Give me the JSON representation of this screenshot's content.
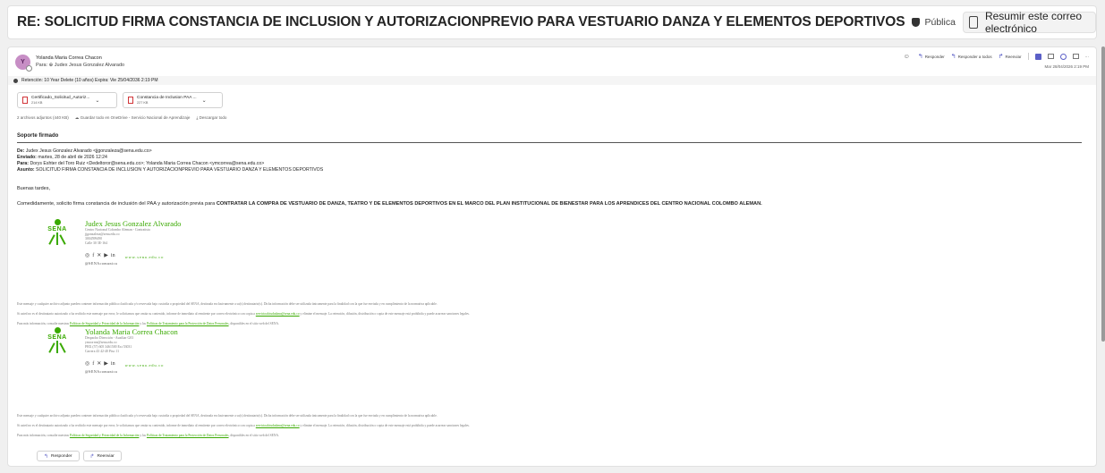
{
  "subject": "RE: SOLICITUD FIRMA CONSTANCIA DE INCLUSION Y AUTORIZACIONPREVIO PARA VESTUARIO DANZA Y ELEMENTOS DEPORTIVOS",
  "label": "Pública",
  "summarize_label": "Resumir este correo electrónico",
  "header": {
    "avatar_initials": "Y",
    "sender_name": "Yolanda Maria Correa Chacon",
    "to_line": "Para: ⊕ Judex Jesus Gonzalez Alvarado",
    "date": "Mar 28/04/2026 2:19 PM",
    "actions": {
      "reply": "Responder",
      "reply_all": "Responder a todos",
      "forward": "Reenviar"
    }
  },
  "retention": "Retención: 10 Year Delete (10 años) Expira: Vie 25/04/2036 2:19 PM",
  "attachments": [
    {
      "name": "Certificado_Solicitud_Autoriz...",
      "size": "214 KB"
    },
    {
      "name": "Constancia de Inclusion PAA ...",
      "size": "227 KB"
    }
  ],
  "attachment_line": {
    "count": "2 archivos adjuntos (440 KB)",
    "save": "Guardar todo en OneDrive - Servicio Nacional de Aprendizaje",
    "download": "Descargar todo"
  },
  "soporte": "Soporte firmado",
  "meta": {
    "from_label": "De:",
    "from": "Judex Jesus Gonzalez Alvarado <jjgonzaleza@sena.edu.co>",
    "sent_label": "Enviado:",
    "sent": "martes, 28 de abril de 2026 12:24",
    "to_label": "Para:",
    "to": "Dorys Eshter del Toro Ruiz <Dedeltoror@sena.edu.co>; Yolanda Maria Correa Chacon <ymcorrea@sena.edu.co>",
    "subject_label": "Asunto:",
    "subject": "SOLICITUD FIRMA CONSTANCIA DE INCLUSION Y AUTORIZACIONPREVIO PARA VESTUARIO DANZA Y ELEMENTOS DEPORTIVOS"
  },
  "greeting": "Buenas tardes,",
  "body_intro": "Comedidamente, solicito firma constancia de inclusión del PAA y autorización previa para",
  "body_bold": "CONTRATAR LA COMPRA DE VESTUARIO DE DANZA, TEATRO Y DE ELEMENTOS DEPORTIVOS EN EL MARCO DEL PLAN INSTITUCIONAL DE BIENESTAR PARA LOS APRENDICES DEL CENTRO NACIONAL COLOMBO ALEMAN.",
  "sena_word": "SENA",
  "sig1": {
    "name": "Judex Jesus Gonzalez Alvarado",
    "line1": "Centro Nacional Colombo Aleman - Contratista",
    "line2": "jjgonzaleza@sena.edu.co",
    "line3": "3004599490",
    "line4": "Calle 30 3E-164"
  },
  "sig2": {
    "name": "Yolanda Maria Correa Chacon",
    "line1": "Despacho Dirección - Auxiliar G03",
    "line2": "ymcorrea@sena.edu.co",
    "line3": "PBX (57) 605 3461500 Ext 53031",
    "line4": "Carrera 43 42-40 Piso 11"
  },
  "web": "www.sena.edu.co",
  "handle": "@SENAcomunica",
  "disclaimer": {
    "p1": "Este mensaje y cualquier archivo adjunto pueden contener información pública clasificada y/o reservada bajo custodia o propiedad del SENA, destinada exclusivamente a su(s) destinatario(s). Dicha información debe ser utilizada únicamente para la finalidad con la que fue enviada y en cumplimiento de la normativa aplicable.",
    "p2a": "Si usted no es el destinatario autorizado o ha recibido este mensaje por error, le solicitamos que omita su contenido, informe de inmediato al remitente por correo electrónico con copia a",
    "p2link": "servicioalciudadano@sena.edu.co",
    "p2b": "y elimine el mensaje. La retención, difusión, distribución o copia de este mensaje está prohibida y puede acarrear sanciones legales.",
    "p3a": "Para más información, consulte nuestras",
    "p3link1": "Políticas de Seguridad y Privacidad de la Información",
    "p3mid": "y las",
    "p3link2": "Políticas de Tratamiento para la Protección de Datos Personales",
    "p3b": ", disponibles en el sitio web del SENA."
  },
  "footer": {
    "reply": "Responder",
    "forward": "Reenviar"
  }
}
